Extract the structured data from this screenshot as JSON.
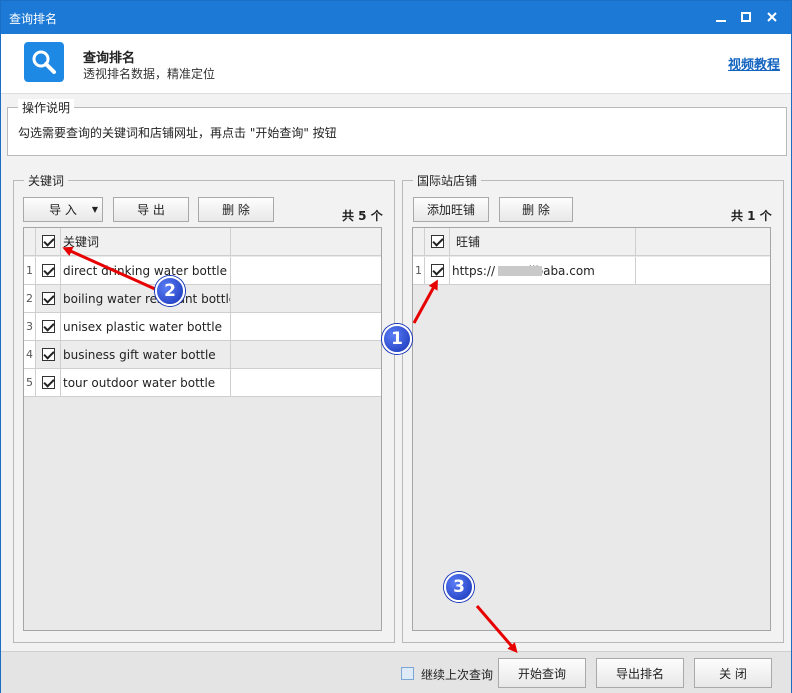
{
  "window": {
    "title": "查询排名"
  },
  "header": {
    "title": "查询排名",
    "subtitle": "透视排名数据，精准定位",
    "video_link": "视频教程"
  },
  "notes": {
    "legend": "操作说明",
    "text": "勾选需要查询的关键词和店铺网址，再点击 \"开始查询\" 按钮"
  },
  "keywords": {
    "legend": "关键词",
    "import_label": "导 入",
    "export_label": "导 出",
    "delete_label": "删 除",
    "count": "共 5 个",
    "column": "关键词",
    "rows": [
      {
        "num": "1",
        "text": "direct drinking water bottle"
      },
      {
        "num": "2",
        "text": "boiling water resistant bottle"
      },
      {
        "num": "3",
        "text": "unisex plastic water bottle"
      },
      {
        "num": "4",
        "text": "business gift water bottle"
      },
      {
        "num": "5",
        "text": "tour outdoor water bottle"
      }
    ]
  },
  "stores": {
    "legend": "国际站店铺",
    "add_label": "添加旺铺",
    "delete_label": "删 除",
    "count": "共 1 个",
    "column": "旺铺",
    "rows": [
      {
        "num": "1",
        "text": "https://        .en.alibaba.com"
      }
    ]
  },
  "footer": {
    "continue_label": "继续上次查询",
    "start_label": "开始查询",
    "export_rank_label": "导出排名",
    "close_label": "关 闭"
  },
  "markers": [
    "1",
    "2",
    "3"
  ],
  "colors": {
    "titlebar": "#1c79d6",
    "accent": "#1e88e5",
    "arrow": "#e60000",
    "marker": "#1634b8"
  }
}
